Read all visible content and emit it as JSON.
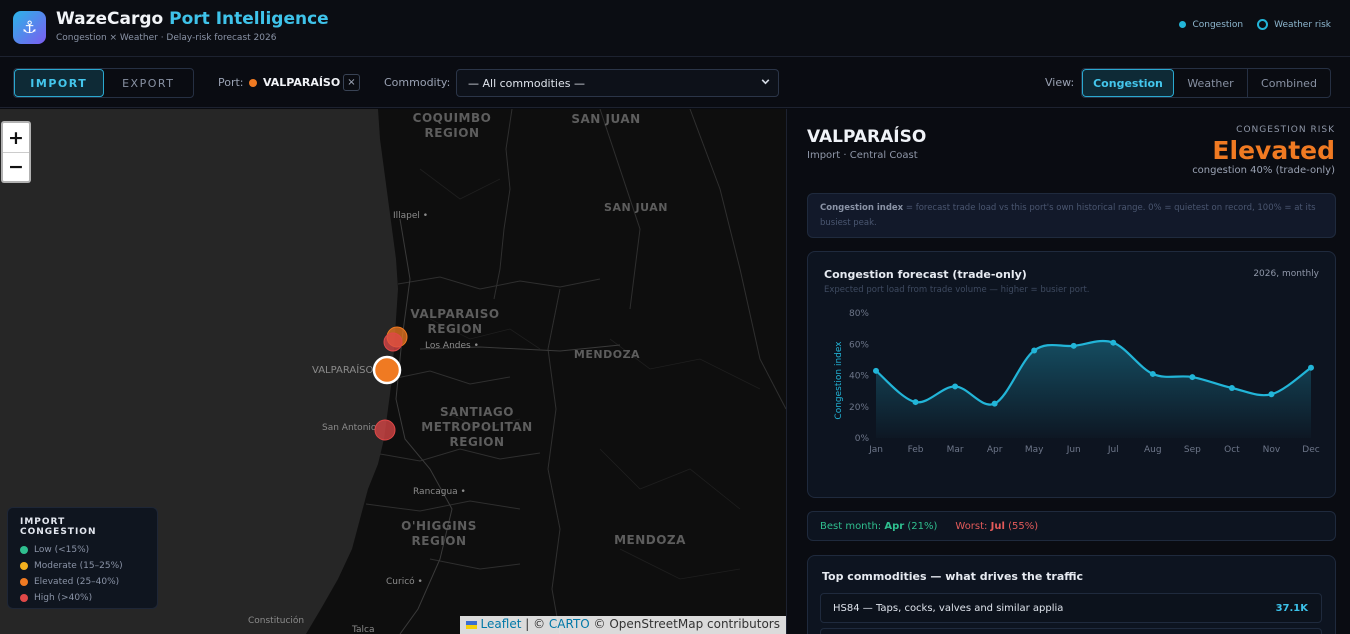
{
  "header": {
    "logo_icon": "anchor-icon",
    "brand_main": "WazeCargo",
    "brand_accent": "Port Intelligence",
    "subtitle": "Congestion × Weather · Delay-risk forecast 2026",
    "legend": {
      "congestion": "Congestion",
      "weather": "Weather risk"
    }
  },
  "toolbar": {
    "direction_tabs": [
      "IMPORT",
      "EXPORT"
    ],
    "port_label": "Port:",
    "port_value": "VALPARAÍSO",
    "port_clear": "×",
    "commodity_label": "Commodity:",
    "commodity_value": "— All commodities —",
    "view_label": "View:",
    "view_tabs": [
      "Congestion",
      "Weather",
      "Combined"
    ]
  },
  "map": {
    "zoom_in": "+",
    "zoom_out": "−",
    "regions": {
      "coquimbo": "COQUIMBO\nREGION",
      "san_juan_1": "SAN JUAN",
      "san_juan_2": "SAN JUAN",
      "valparaiso": "VALPARAISO\nREGION",
      "mendoza_1": "MENDOZA",
      "santiago": "SANTIAGO\nMETROPOLITAN\nREGION",
      "ohiggins": "O'HIGGINS\nREGION",
      "mendoza_2": "MENDOZA"
    },
    "cities": {
      "illapel": "Illapel",
      "los_andes": "Los Andes",
      "valparaiso": "VALPARAÍSO",
      "san_antonio": "San Antonio",
      "rancagua": "Rancagua",
      "curico": "Curicó",
      "constitucion": "Constitución",
      "talca": "Talca"
    },
    "legend": {
      "title": "IMPORT CONGESTION",
      "items": [
        {
          "label": "Low (<15%)",
          "color": "#2fbf8f"
        },
        {
          "label": "Moderate (15–25%)",
          "color": "#f2b01e"
        },
        {
          "label": "Elevated (25–40%)",
          "color": "#f07a22"
        },
        {
          "label": "High (>40%)",
          "color": "#e04848"
        }
      ]
    },
    "attribution": {
      "leaflet": "Leaflet",
      "sep1": " | © ",
      "carto": "CARTO",
      "rest": " © OpenStreetMap contributors"
    }
  },
  "panel": {
    "port_name": "VALPARAÍSO",
    "port_sub": "Import · Central Coast",
    "risk_label": "CONGESTION RISK",
    "risk_value": "Elevated",
    "risk_sub": "congestion 40% (trade-only)",
    "note_bold": "Congestion index",
    "note_text": " = forecast trade load vs this port's own historical range. 0% = quietest on record, 100% = at its busiest peak.",
    "chart_title": "Congestion forecast (trade-only)",
    "chart_range": "2026, monthly",
    "chart_subtitle": "Expected port load from trade volume — higher = busier port.",
    "best_label": "Best month: ",
    "best_month": "Apr",
    "best_value": " (21%)",
    "worst_label": "Worst: ",
    "worst_month": "Jul",
    "worst_value": " (55%)",
    "commod_title": "Top commodities — what drives the traffic",
    "commod_rows": [
      {
        "name": "HS84 — Taps, cocks, valves and similar applia",
        "value": "37.1K"
      }
    ]
  },
  "colors": {
    "accent": "#3fc3ea",
    "elevated": "#f07a22",
    "high": "#e04848",
    "good": "#2fbf8f"
  },
  "chart_data": {
    "type": "area",
    "title": "Congestion forecast (trade-only)",
    "subtitle": "Expected port load from trade volume — higher = busier port.",
    "ylabel": "Congestion index",
    "xlabel": "",
    "categories": [
      "Jan",
      "Feb",
      "Mar",
      "Apr",
      "May",
      "Jun",
      "Jul",
      "Aug",
      "Sep",
      "Oct",
      "Nov",
      "Dec"
    ],
    "values": [
      43,
      23,
      33,
      22,
      56,
      59,
      61,
      41,
      39,
      32,
      28,
      45
    ],
    "ylim": [
      0,
      80
    ],
    "yticks": [
      "0%",
      "20%",
      "40%",
      "60%",
      "80%"
    ],
    "color": "#22b5d8"
  }
}
